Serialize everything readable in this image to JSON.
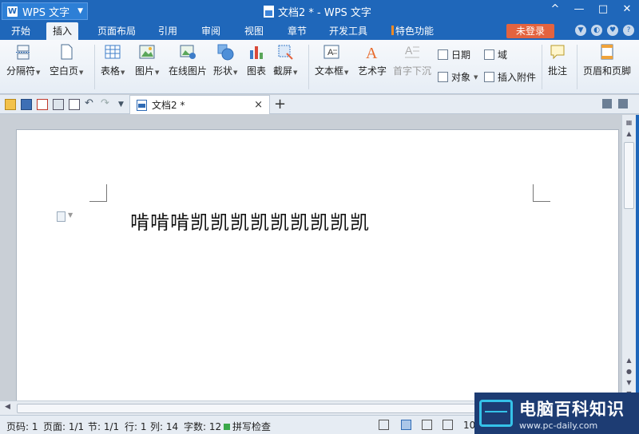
{
  "title_bar": {
    "app_name": "WPS 文字",
    "doc_title": "文档2 * - WPS 文字",
    "controls": [
      "^",
      "—",
      "□",
      "✕"
    ]
  },
  "menu": {
    "tabs": [
      "开始",
      "插入",
      "页面布局",
      "引用",
      "审阅",
      "视图",
      "章节",
      "开发工具",
      "特色功能"
    ],
    "active_tab": "插入",
    "login_label": "未登录",
    "help": "?"
  },
  "ribbon": {
    "page_break": "分隔符",
    "blank_page": "空白页",
    "table": "表格",
    "picture": "图片",
    "online_picture": "在线图片",
    "shapes": "形状",
    "chart": "图表",
    "screenshot": "截屏",
    "textbox": "文本框",
    "wordart": "艺术字",
    "dropcap": "首字下沉",
    "date": "日期",
    "field": "域",
    "object": "对象",
    "attachment": "插入附件",
    "comment": "批注",
    "header_footer": "页眉和页脚"
  },
  "doc_tab": {
    "label": "文档2 *",
    "close": "×",
    "new": "+"
  },
  "document": {
    "text": "啃啃啃凯凯凯凯凯凯凯凯凯"
  },
  "status": {
    "page_num": "页码: 1",
    "pages": "页面: 1/1",
    "section": "节: 1/1",
    "row": "行: 1",
    "col": "列: 14",
    "words": "字数: 12",
    "spell": "拼写检查",
    "zoom": "10"
  },
  "watermark": {
    "title": "电脑百科知识",
    "url": "www.pc-daily.com"
  },
  "colors": {
    "title_bg": "#1f67ba",
    "login_bg": "#e3633f",
    "accent": "#f08a24"
  }
}
